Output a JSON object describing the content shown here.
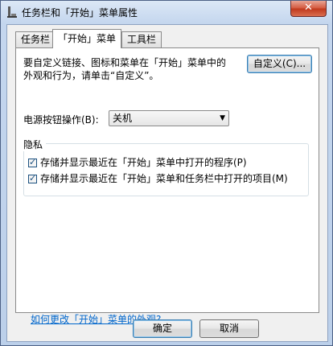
{
  "window": {
    "title": "任务栏和「开始」菜单属性",
    "close_glyph": "✕"
  },
  "tabs": [
    {
      "label": "任务栏",
      "active": false
    },
    {
      "label": "「开始」菜单",
      "active": true
    },
    {
      "label": "工具栏",
      "active": false
    }
  ],
  "start_menu": {
    "description_line1": "要自定义链接、图标和菜单在「开始」菜单中的",
    "description_line2": "外观和行为，请单击“自定义”。",
    "customize_button": "自定义(C)...",
    "power_label": "电源按钮操作(B):",
    "power_value": "关机",
    "privacy_title": "隐私",
    "privacy_items": [
      {
        "label": "存储并显示最近在「开始」菜单中打开的程序(P)",
        "checked": true
      },
      {
        "label": "存储并显示最近在「开始」菜单和任务栏中打开的项目(M)",
        "checked": true
      }
    ],
    "help_link": "如何更改「开始」菜单的外观?"
  },
  "footer": {
    "ok_button": "确定",
    "cancel_button": "取消"
  },
  "colors": {
    "accent": "#3c7fb1",
    "link": "#0066cc",
    "close": "#c0391d"
  }
}
